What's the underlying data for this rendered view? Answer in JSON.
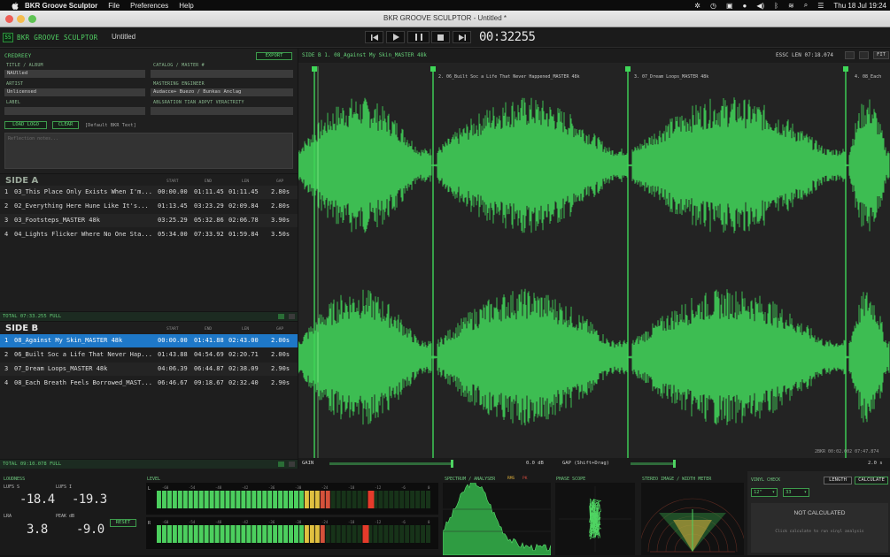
{
  "menubar": {
    "app_name": "BKR Groove Sculptor",
    "menus": [
      "File",
      "Preferences",
      "Help"
    ],
    "clock": "Thu 18 Jul 19:24"
  },
  "window": {
    "title": "BKR GROOVE SCULPTOR - Untitled *"
  },
  "toolbar": {
    "logo_text": "55",
    "brand": "BKR GROOVE SCULPTOR",
    "doc_name": "Untitled",
    "timecode": "00:32255"
  },
  "metadata": {
    "section_label": "CREDREEY",
    "export_label": "EXPORT",
    "fields": {
      "title_label": "TITLE / ALBUM",
      "title_value": "NAUlled",
      "artist_label": "ARTIST",
      "artist_value": "Unlicensed",
      "label_label": "LABEL",
      "label_value": "",
      "catalog_label": "CATALOG / MASTER #",
      "catalog_value": "",
      "mastered_label": "MASTERING ENGINEER",
      "mastered_value": "Audacce+ Buezo / Bunkas Anclag",
      "notes_label": "ABLSRATION TIAN ADPVT VERACTRITY",
      "notes_value": ""
    },
    "load_logo": "LOAD LOGO",
    "clear": "CLEAR",
    "logo_hint": "[Default BKR Text]",
    "notes_placeholder": "Reflection notes..."
  },
  "side_a": {
    "header": "SIDE A",
    "columns": [
      "START",
      "END",
      "LEN",
      "GAP"
    ],
    "tracks": [
      {
        "n": "1",
        "name": "03_This Place Only Exists When I'm...",
        "start": "00:00.00",
        "end": "01:11.45",
        "len": "01:11.45",
        "gap": "2.80s"
      },
      {
        "n": "2",
        "name": "02_Everything Here Hune Like It's...",
        "start": "01:13.45",
        "end": "03:23.29",
        "len": "02:09.84",
        "gap": "2.80s"
      },
      {
        "n": "3",
        "name": "03_Footsteps_MASTER 48k",
        "start": "03:25.29",
        "end": "05:32.86",
        "len": "02:06.78",
        "gap": "3.90s"
      },
      {
        "n": "4",
        "name": "04_Lights Flicker Where No One Sta...",
        "start": "05:34.00",
        "end": "07:33.92",
        "len": "01:59.84",
        "gap": "3.50s"
      }
    ],
    "total": "TOTAL 07:33.255   FULL"
  },
  "side_b": {
    "header": "SIDE B",
    "columns": [
      "START",
      "END",
      "LEN",
      "GAP"
    ],
    "tracks": [
      {
        "n": "1",
        "name": "08_Against My Skin_MASTER 48k",
        "start": "00:00.00",
        "end": "01:41.88",
        "len": "02:43.00",
        "gap": "2.00s"
      },
      {
        "n": "2",
        "name": "06_Built Soc a Life That Never Hap...",
        "start": "01:43.88",
        "end": "04:54.69",
        "len": "02:20.71",
        "gap": "2.00s"
      },
      {
        "n": "3",
        "name": "07_Dream Loops_MASTER 48k",
        "start": "04:06.39",
        "end": "06:44.87",
        "len": "02:38.09",
        "gap": "2.90s"
      },
      {
        "n": "4",
        "name": "08_Each Breath Feels Borrowed_MAST...",
        "start": "06:46.67",
        "end": "09:18.67",
        "len": "02:32.40",
        "gap": "2.90s"
      }
    ],
    "total": "TOTAL 09:10.078   FULL"
  },
  "waveform": {
    "header": "SIDE B   1. 08_Against My Skin_MASTER 48k",
    "side_len": "ESSC LEN 07:18.074",
    "fit": "FIT",
    "markers": [
      "2. 06_Built Soc a Life That Never Happened_MASTER 48k",
      "3. 07_Dream Loops_MASTER 48k",
      "4. 08_Each"
    ],
    "gain_label": "GAIN",
    "gain_value": "0.0 dB",
    "gap_label": "GAP (Shift+Drag)",
    "gap_value": "2.0 s",
    "info": "2BKR 00:02.002   07:47.874"
  },
  "loudness": {
    "title": "LOUDNESS",
    "lufs_label": "LUFS S",
    "lufs_value": "-18.4",
    "lufsi_label": "LUFS I",
    "lufsi_value": "-19.3",
    "lra_label": "LRA",
    "lra_value": "3.8",
    "peak_label": "PEAK dB",
    "peak_value": "-9.0",
    "reset": "RESET"
  },
  "level": {
    "title": "LEVEL",
    "left": "L",
    "right": "R",
    "scale": [
      "-60",
      "-54",
      "-48",
      "-42",
      "-36",
      "-30",
      "-24",
      "-18",
      "-12",
      "-6",
      "0"
    ],
    "l_level": 0.64,
    "r_level": 0.62
  },
  "spectrum": {
    "title": "SPECTRUM / ANALYSER",
    "tag_a": "RMS",
    "tag_b": "PK"
  },
  "phase": {
    "title": "PHASE SCOPE"
  },
  "stereo": {
    "title": "STEREO IMAGE / WIDTH METER"
  },
  "vinyl": {
    "title": "VINYL CHECK",
    "select_a": "12\"",
    "select_b": "33",
    "length_btn": "LENGTH",
    "calc_btn": "CALCULATE",
    "status": "NOT CALCULATED",
    "hint": "Click calculate to run vinyl analysis"
  },
  "colors": {
    "accent": "#4fd462",
    "wave": "#3fc655",
    "select": "#1e78c8"
  }
}
